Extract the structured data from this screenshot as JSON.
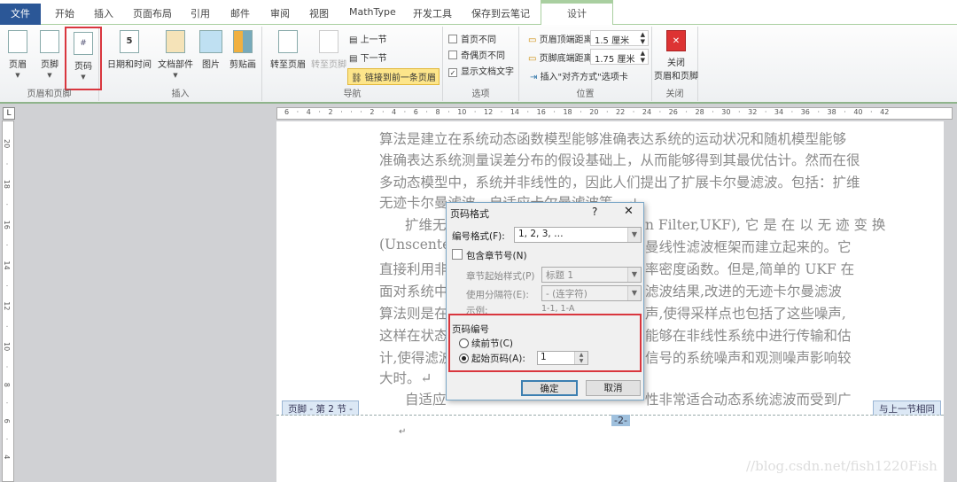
{
  "tabs": {
    "file": "文件",
    "items": [
      "开始",
      "插入",
      "页面布局",
      "引用",
      "邮件",
      "审阅",
      "视图",
      "MathType",
      "开发工具",
      "保存到云笔记"
    ],
    "active": "设计"
  },
  "ribbon": {
    "hf_group": {
      "label": "页眉和页脚",
      "header": "页眉",
      "footer": "页脚",
      "page_number": "页码"
    },
    "insert_group": {
      "label": "插入",
      "datetime": "日期和时间",
      "docparts": "文档部件",
      "picture": "图片",
      "clipart": "剪贴画"
    },
    "nav_group": {
      "label": "导航",
      "goto_header": "转至页眉",
      "goto_footer": "转至页脚",
      "prev": "上一节",
      "next": "下一节",
      "link_prev": "链接到前一条页眉"
    },
    "options_group": {
      "label": "选项",
      "first_page": "首页不同",
      "odd_even": "奇偶页不同",
      "show_text": "显示文档文字",
      "show_text_check": "✓"
    },
    "position_group": {
      "label": "位置",
      "header_top": "页眉顶端距离:",
      "header_top_value": "1.5 厘米",
      "footer_bottom": "页脚底端距离:",
      "footer_bottom_value": "1.75 厘米",
      "insert_align": "插入\"对齐方式\"选项卡"
    },
    "close_group": {
      "label": "关闭",
      "close_btn": "关闭\n页眉和页脚",
      "close_icon": "✕"
    }
  },
  "ruler": "6 · 4 · 2 · ·  · 2 · 4 · 6 · 8 · 10 · 12 · 14 · 16 · 18 · 20 · 22 · 24 · 26 · 28 · 30 · 32 · 34 · 36 · 38 · 40 · 42",
  "vruler": "20 · 18 · 16 · 14 · 12 · 10 · 8 · 6 · 4",
  "document": {
    "lines": [
      [
        "算法是建立在系统动态函数模型能够准确表达系统的运动状况和随机模型能够",
        ""
      ],
      [
        "准确表达系统测量误差分布的假设基础上，从而能够得到其最优估计。然而在很",
        ""
      ],
      [
        "多动态模型中，系统并非线性的，因此人们提出了扩展卡尔曼滤波。包括：扩维",
        ""
      ],
      [
        "无迹卡尔曼滤波，自适应卡尔曼滤波等。↵",
        ""
      ],
      [
        "扩维无",
        "n Filter,UKF), 它 是 在 以 无 迹 变 换"
      ],
      [
        "(Unscented",
        "曼线性滤波框架而建立起来的。它"
      ],
      [
        "直接利用非",
        "率密度函数。但是,简单的 UKF 在"
      ],
      [
        "面对系统中",
        "滤波结果,改进的无迹卡尔曼滤波"
      ],
      [
        "算法则是在",
        "声,使得采样点也包括了这些噪声,"
      ],
      [
        "这样在状态",
        "能够在非线性系统中进行传输和估"
      ],
      [
        "计,使得滤波",
        "信号的系统噪声和观测噪声影响较"
      ],
      [
        "大时。↵",
        ""
      ],
      [
        "自适应",
        "性非常适合动态系统滤波而受到广"
      ]
    ],
    "footer_tab": "页脚 - 第 2 节 -",
    "same_as_prev": "与上一节相同",
    "page_num": "-2-",
    "para_mark": "↵",
    "watermark": "//blog.csdn.net/fish1220Fish"
  },
  "dialog": {
    "title": "页码格式",
    "help": "?",
    "close": "✕",
    "format_label": "编号格式(F):",
    "format_value": "1, 2, 3, …",
    "include_chapter": "包含章节号(N)",
    "chapter_style_label": "章节起始样式(P)",
    "chapter_style_value": "标题 1",
    "separator_label": "使用分隔符(E):",
    "separator_value": "-  (连字符)",
    "example_label": "示例:",
    "example_value": "1-1, 1-A",
    "numbering_section": "页码编号",
    "continue": "续前节(C)",
    "start_at": "起始页码(A):",
    "start_value": "1",
    "ok": "确定",
    "cancel": "取消"
  },
  "colors": {
    "file_tab": "#2b5797",
    "highlight_box": "#d9363e",
    "text_dim": "#8a8a8a"
  }
}
